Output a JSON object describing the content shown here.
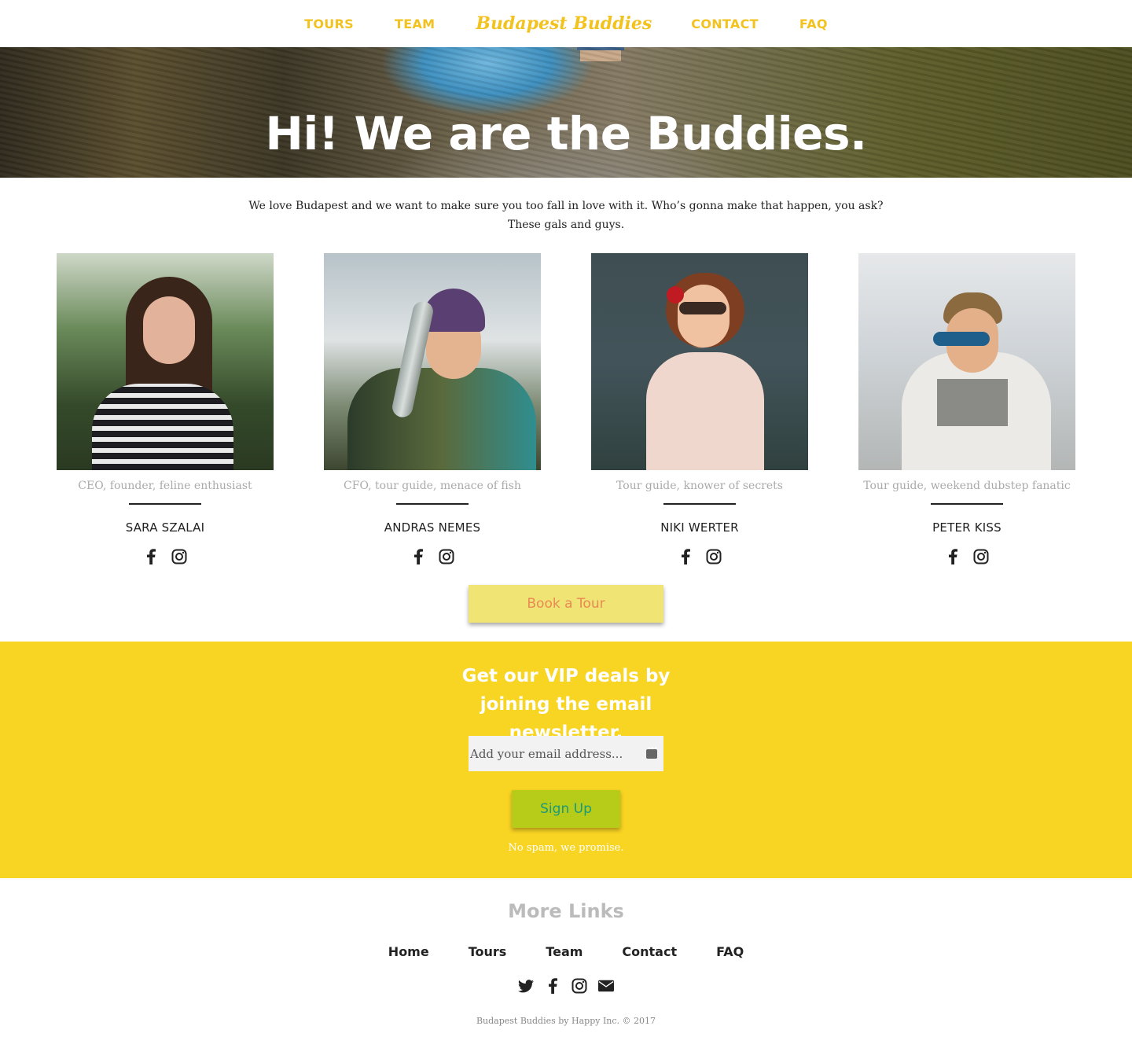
{
  "nav": {
    "links": [
      "TOURS",
      "TEAM",
      "CONTACT",
      "FAQ"
    ],
    "brand": "Budapest Buddies"
  },
  "hero": {
    "title": "Hi! We are the Buddies."
  },
  "intro": {
    "line1": "We love Budapest and we want to make sure you too fall in love with it. Who’s gonna make that happen, you ask?",
    "line2": "These gals and guys."
  },
  "team": [
    {
      "role": "CEO, founder, feline enthusiast",
      "name": "SARA SZALAI"
    },
    {
      "role": "CFO, tour guide, menace of fish",
      "name": "ANDRAS NEMES"
    },
    {
      "role": "Tour guide, knower of secrets",
      "name": "NIKI WERTER"
    },
    {
      "role": "Tour guide, weekend dubstep fanatic",
      "name": "PETER KISS"
    }
  ],
  "book": {
    "label": "Book a Tour"
  },
  "newsletter": {
    "title": "Get our VIP deals by joining the email newsletter.",
    "placeholder": "Add your email address...",
    "signup": "Sign Up",
    "note": "No spam, we promise."
  },
  "footer": {
    "heading": "More Links",
    "links": [
      "Home",
      "Tours",
      "Team",
      "Contact",
      "FAQ"
    ],
    "copyright": "Budapest Buddies by Happy Inc. © 2017"
  },
  "colors": {
    "accent": "#f2c21f",
    "newsletter_bg": "#f8d423",
    "book_bg": "#f0e475",
    "signup_bg": "#b6cc18"
  },
  "icons": [
    "facebook-icon",
    "instagram-icon",
    "twitter-icon",
    "envelope-icon"
  ]
}
